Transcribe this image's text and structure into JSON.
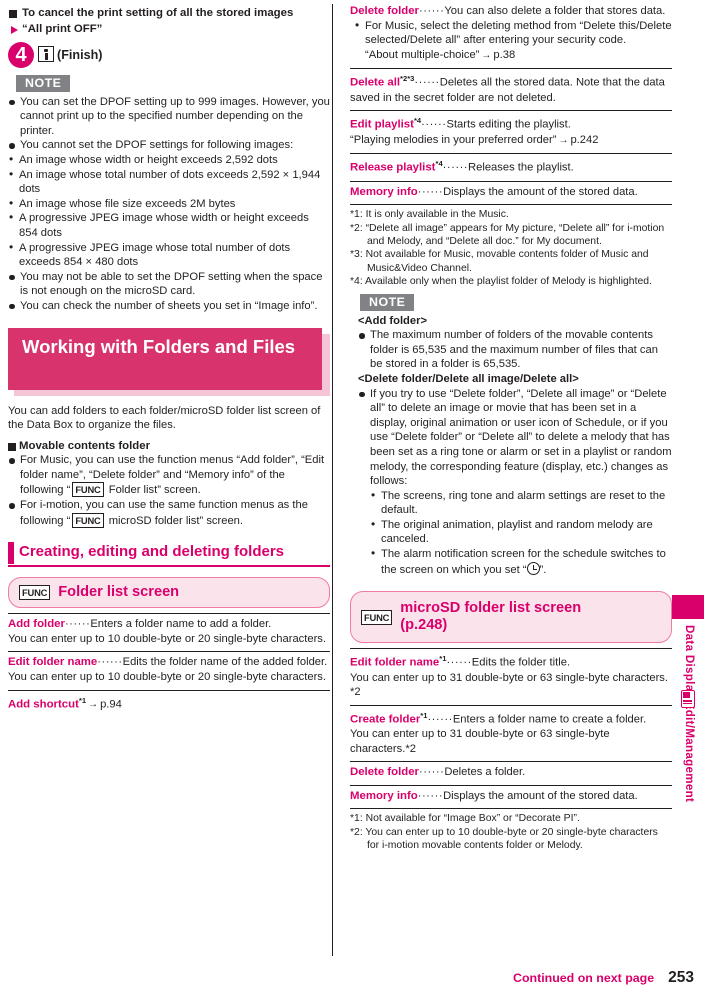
{
  "page": {
    "number": "253",
    "continued": "Continued on next page",
    "side_tab_label": "Data Display/Edit/Management"
  },
  "left": {
    "cancel_head": "To cancel the print setting of all the stored images",
    "cancel_option": "“All print OFF”",
    "step": {
      "number": "4",
      "label": "(Finish)"
    },
    "note_label": "NOTE",
    "notes": [
      "You can set the DPOF setting up to 999 images. However, you cannot print up to the specified number depending on the printer.",
      "You cannot set the DPOF settings for following images:",
      "You may not be able to set the DPOF setting when the space is not enough on the microSD card.",
      "You can check the number of sheets you set in “Image info”."
    ],
    "note_sublist": [
      "An image whose width or height exceeds 2,592 dots",
      "An image whose total number of dots exceeds 2,592 × 1,944 dots",
      "An image whose file size exceeds 2M bytes",
      "A progressive JPEG image whose width or height exceeds 854 dots",
      "A progressive JPEG image whose total number of dots exceeds 854 × 480 dots"
    ],
    "banner_title": "Working with Folders and Files",
    "intro": "You can add folders to each folder/microSD folder list screen of the Data Box to organize the files.",
    "movable_head": "Movable contents folder",
    "movable_items": [
      "For Music, you can use the function menus “Add folder”, “Edit folder name”, “Delete folder” and “Memory info” of the following “",
      "For i-motion, you can use the same function menus as the following “"
    ],
    "movable_items_tail": [
      " Folder list” screen.",
      " microSD folder list” screen."
    ],
    "func_tag": "FUNC",
    "section_head": "Creating, editing and deleting folders",
    "panel_title": "Folder list screen",
    "entries": [
      {
        "term": "Add folder",
        "dots": "······",
        "desc": "Enters a folder name to add a folder.",
        "extra": "You can enter up to 10 double-byte or 20 single-byte characters."
      },
      {
        "term": "Edit folder name",
        "dots": "······",
        "desc": "Edits the folder name of the added folder.",
        "extra": "You can enter up to 10 double-byte or 20 single-byte characters."
      },
      {
        "term": "Add shortcut",
        "sup": "*1",
        "arrow": "→",
        "ref": "p.94"
      }
    ]
  },
  "right": {
    "entries_top": [
      {
        "term": "Delete folder",
        "dots": "······",
        "desc": "You can also delete a folder that stores data.",
        "bullet": "For Music, select the deleting method from “Delete this/Delete selected/Delete all” after entering your security code.",
        "bullet_ref": "“About multiple-choice”",
        "bullet_arrow": "→",
        "bullet_page": "p.38"
      },
      {
        "term": "Delete all",
        "sup": "*2*3",
        "dots": "······",
        "desc": "Deletes all the stored data. Note that the data saved in the secret folder are not deleted."
      },
      {
        "term": "Edit playlist",
        "sup": "*4",
        "dots": "······",
        "desc": "Starts editing the playlist.",
        "extra": "“Playing melodies in your preferred order”",
        "extra_arrow": "→",
        "extra_page": "p.242"
      },
      {
        "term": "Release playlist",
        "sup": "*4",
        "dots": "······",
        "desc": "Releases the playlist."
      },
      {
        "term": "Memory info",
        "dots": "······",
        "desc": "Displays the amount of the stored data."
      }
    ],
    "footnotes_top": [
      "*1: It is only available in the Music.",
      "*2: “Delete all image” appears for My picture, “Delete all” for i-motion and Melody, and “Delete all doc.” for My document.",
      "*3: Not available for Music, movable contents folder of Music and Music&Video Channel.",
      "*4: Available only when the playlist folder of Melody is highlighted."
    ],
    "note_label": "NOTE",
    "note_head_1": "<Add folder>",
    "note_item_1": "The maximum number of folders of the movable contents folder is 65,535 and the maximum number of files that can be stored in a folder is 65,535.",
    "note_head_2": "<Delete folder/Delete all image/Delete all>",
    "note_item_2": "If you try to use “Delete folder”, “Delete all image” or “Delete all” to delete an image or movie that has been set in a display, original animation or user icon of Schedule, or if you use “Delete folder” or “Delete all” to delete a melody that has been set as a ring tone or alarm or set in a playlist or random melody, the corresponding feature (display, etc.) changes as follows:",
    "note_sublist_2": [
      "The screens, ring tone and alarm settings are reset to the default.",
      "The original animation, playlist and random melody are canceled.",
      "The alarm notification screen for the schedule switches to the screen on which you set “"
    ],
    "note_sublist_2_tail": "”.",
    "func_tag": "FUNC",
    "panel_title_line1": "microSD folder list screen",
    "panel_title_line2": "(p.248)",
    "entries_bottom": [
      {
        "term": "Edit folder name",
        "sup": "*1",
        "dots": "······",
        "desc": "Edits the folder title.",
        "extra": "You can enter up to 31 double-byte or 63 single-byte characters. *2"
      },
      {
        "term": "Create folder",
        "sup": "*1",
        "dots": "······",
        "desc": "Enters a folder name to create a folder.",
        "extra": "You can enter up to 31 double-byte or 63 single-byte characters.*2"
      },
      {
        "term": "Delete folder",
        "dots": "······",
        "desc": "Deletes a folder."
      },
      {
        "term": "Memory info",
        "dots": "······",
        "desc": "Displays the amount of the stored data."
      }
    ],
    "footnotes_bottom": [
      "*1: Not available for “Image Box” or “Decorate PI”.",
      "*2: You can enter up to 10 double-byte or 20 single-byte characters for i-motion movable contents folder or Melody."
    ]
  },
  "colors": {
    "accent": "#d9006c",
    "banner": "#d8336d",
    "banner_shadow": "#f6c4d7",
    "panel_bg": "#fbe3ec",
    "panel_border": "#ef7ba6",
    "note_badge": "#808285"
  }
}
